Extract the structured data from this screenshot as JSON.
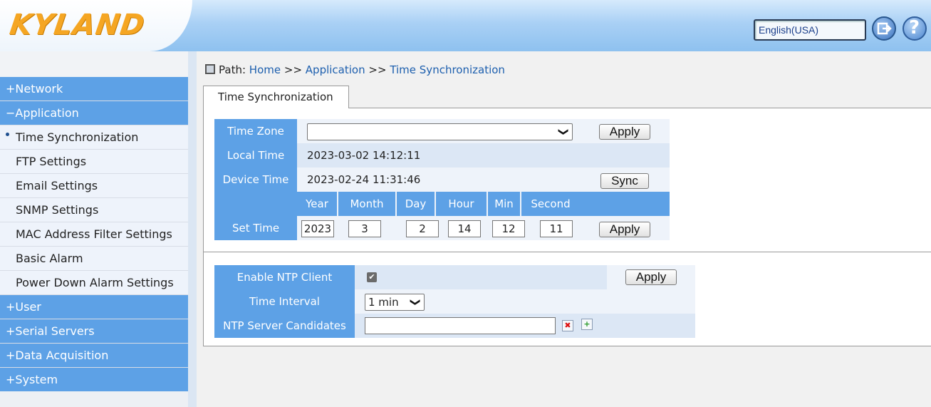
{
  "header": {
    "logo_text": "KYLAND",
    "language": "English(USA)",
    "logout_icon": "logout-icon",
    "help_icon": "help-icon",
    "help_glyph": "?"
  },
  "sidebar": {
    "items": [
      {
        "label": "+Network",
        "type": "group"
      },
      {
        "label": "−Application",
        "type": "group"
      },
      {
        "label": "Time Synchronization",
        "type": "sub",
        "active": true
      },
      {
        "label": "FTP Settings",
        "type": "sub"
      },
      {
        "label": "Email Settings",
        "type": "sub"
      },
      {
        "label": "SNMP Settings",
        "type": "sub"
      },
      {
        "label": "MAC Address Filter Settings",
        "type": "sub"
      },
      {
        "label": "Basic Alarm",
        "type": "sub"
      },
      {
        "label": "Power Down Alarm Settings",
        "type": "sub"
      },
      {
        "label": "+User",
        "type": "group"
      },
      {
        "label": "+Serial Servers",
        "type": "group"
      },
      {
        "label": "+Data Acquisition",
        "type": "group"
      },
      {
        "label": "+System",
        "type": "group"
      }
    ]
  },
  "path": {
    "label": "Path:",
    "home": "Home",
    "sep1": ">>",
    "application": "Application",
    "sep2": ">>",
    "current": "Time Synchronization"
  },
  "tab": {
    "label": "Time Synchronization"
  },
  "time_form": {
    "time_zone_label": "Time Zone",
    "time_zone_value": "",
    "local_time_label": "Local Time",
    "local_time_value": "2023-03-02 14:12:11",
    "device_time_label": "Device Time",
    "device_time_value": "2023-02-24 11:31:46",
    "set_time_label": "Set Time",
    "columns": [
      "Year",
      "Month",
      "Day",
      "Hour",
      "Min",
      "Second"
    ],
    "values": [
      "2023",
      "3",
      "2",
      "14",
      "12",
      "11"
    ],
    "apply_label": "Apply",
    "sync_label": "Sync"
  },
  "ntp_form": {
    "enable_label": "Enable NTP Client",
    "enable_checked": true,
    "check_glyph": "✔",
    "interval_label": "Time Interval",
    "interval_value": "1 min",
    "servers_label": "NTP Server Candidates",
    "servers_value": "",
    "apply_label": "Apply",
    "delete_icon_glyph": "✖",
    "add_icon_glyph": "+"
  },
  "colors": {
    "accent_blue": "#5da1e6",
    "light_row": "#dce7f5",
    "header_gradient": "#8ec1ef",
    "logo_orange": "#f5a623",
    "link_blue": "#1d5fae"
  }
}
